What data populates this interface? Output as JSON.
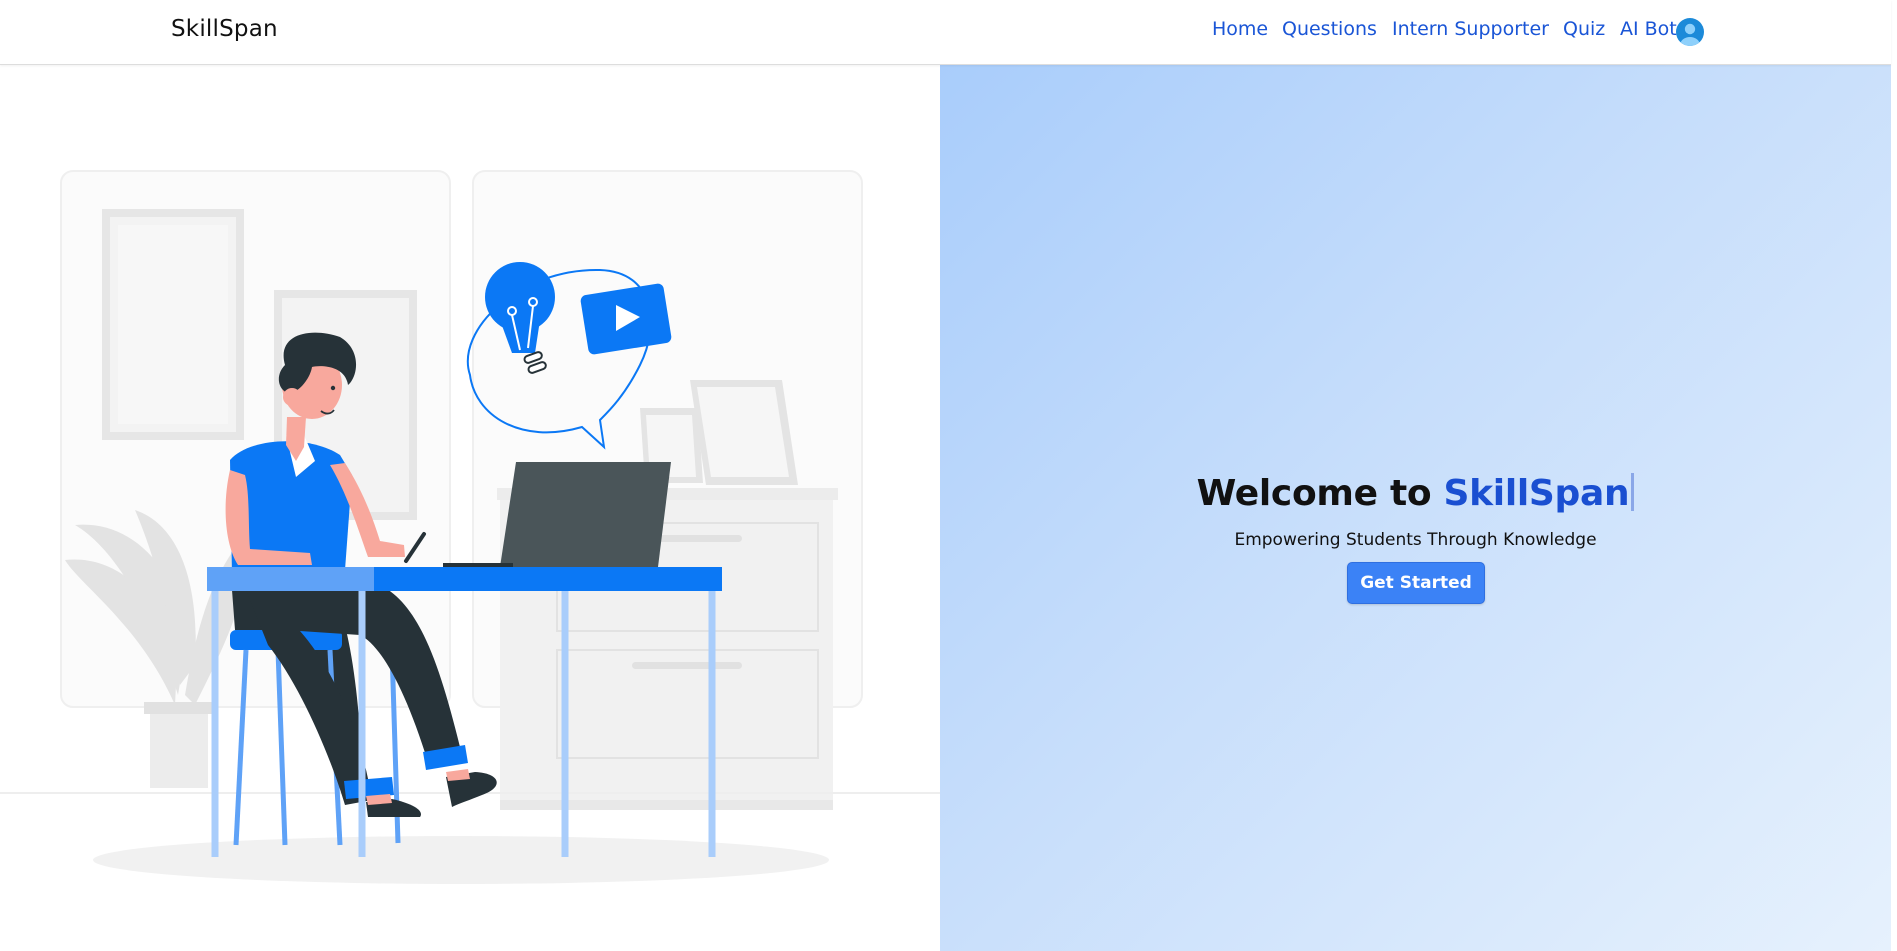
{
  "navbar": {
    "brand": "SkillSpan",
    "links": [
      {
        "label": "Home"
      },
      {
        "label": "Questions"
      },
      {
        "label": "Intern Supporter"
      },
      {
        "label": "Quiz"
      },
      {
        "label": "AI Bot"
      }
    ],
    "avatar_icon": "user-avatar-icon"
  },
  "hero": {
    "title_prefix": "Welcome to ",
    "title_accent": "SkillSpan",
    "subtitle": "Empowering Students Through Knowledge",
    "cta_label": "Get Started"
  },
  "colors": {
    "accent": "#1a4fd1",
    "button": "#3b82f6",
    "illustration_blue": "#0b78f5",
    "hero_gradient_start": "#a9cdfb",
    "hero_gradient_end": "#e6f1fd"
  }
}
